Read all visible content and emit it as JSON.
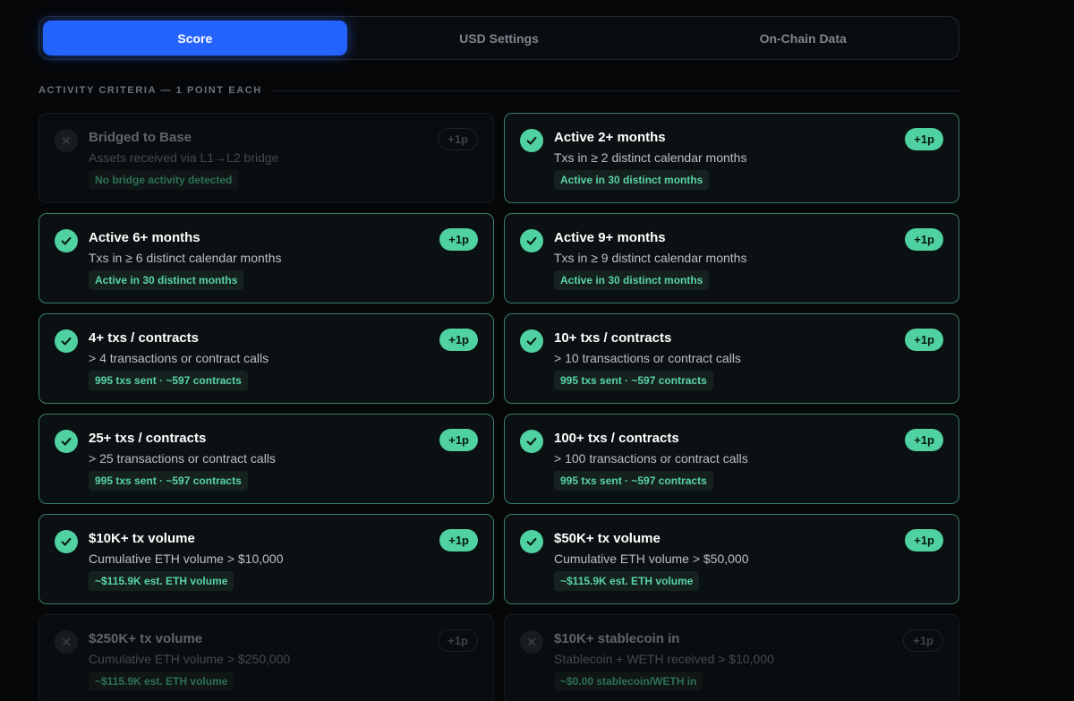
{
  "tabs": [
    {
      "label": "Score",
      "active": true
    },
    {
      "label": "USD Settings",
      "active": false
    },
    {
      "label": "On-Chain Data",
      "active": false
    }
  ],
  "section": {
    "title": "ACTIVITY CRITERIA — 1 POINT EACH"
  },
  "colors": {
    "accent_blue": "#2563ff",
    "accent_green": "#4fd1a1",
    "background": "#050709"
  },
  "icons": {
    "met": "check-icon",
    "unmet": "x-icon"
  },
  "criteria": [
    {
      "title": "Bridged to Base",
      "desc": "Assets received via L1→L2 bridge",
      "detail": "No bridge activity detected",
      "points": "+1p",
      "met": false
    },
    {
      "title": "Active 2+ months",
      "desc": "Txs in ≥ 2 distinct calendar months",
      "detail": "Active in 30 distinct months",
      "points": "+1p",
      "met": true
    },
    {
      "title": "Active 6+ months",
      "desc": "Txs in ≥ 6 distinct calendar months",
      "detail": "Active in 30 distinct months",
      "points": "+1p",
      "met": true
    },
    {
      "title": "Active 9+ months",
      "desc": "Txs in ≥ 9 distinct calendar months",
      "detail": "Active in 30 distinct months",
      "points": "+1p",
      "met": true
    },
    {
      "title": "4+ txs / contracts",
      "desc": "> 4 transactions or contract calls",
      "detail": "995 txs sent · ~597 contracts",
      "points": "+1p",
      "met": true
    },
    {
      "title": "10+ txs / contracts",
      "desc": "> 10 transactions or contract calls",
      "detail": "995 txs sent · ~597 contracts",
      "points": "+1p",
      "met": true
    },
    {
      "title": "25+ txs / contracts",
      "desc": "> 25 transactions or contract calls",
      "detail": "995 txs sent · ~597 contracts",
      "points": "+1p",
      "met": true
    },
    {
      "title": "100+ txs / contracts",
      "desc": "> 100 transactions or contract calls",
      "detail": "995 txs sent · ~597 contracts",
      "points": "+1p",
      "met": true
    },
    {
      "title": "$10K+ tx volume",
      "desc": "Cumulative ETH volume > $10,000",
      "detail": "~$115.9K est. ETH volume",
      "points": "+1p",
      "met": true
    },
    {
      "title": "$50K+ tx volume",
      "desc": "Cumulative ETH volume > $50,000",
      "detail": "~$115.9K est. ETH volume",
      "points": "+1p",
      "met": true
    },
    {
      "title": "$250K+ tx volume",
      "desc": "Cumulative ETH volume > $250,000",
      "detail": "~$115.9K est. ETH volume",
      "points": "+1p",
      "met": false
    },
    {
      "title": "$10K+ stablecoin in",
      "desc": "Stablecoin + WETH received > $10,000",
      "detail": "~$0.00 stablecoin/WETH in",
      "points": "+1p",
      "met": false
    }
  ]
}
